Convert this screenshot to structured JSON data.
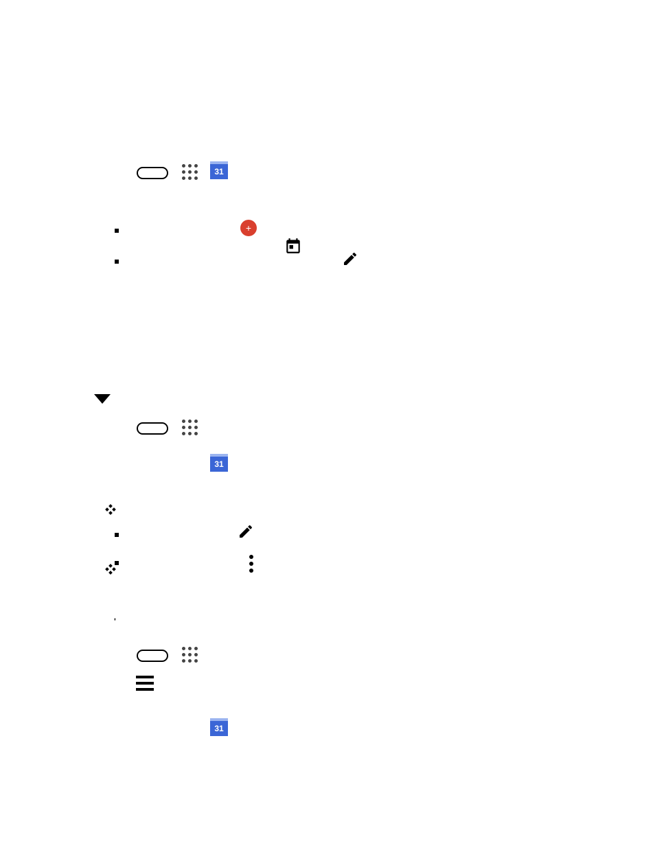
{
  "icons": {
    "calendar_label": "31",
    "plus_label": "+"
  }
}
